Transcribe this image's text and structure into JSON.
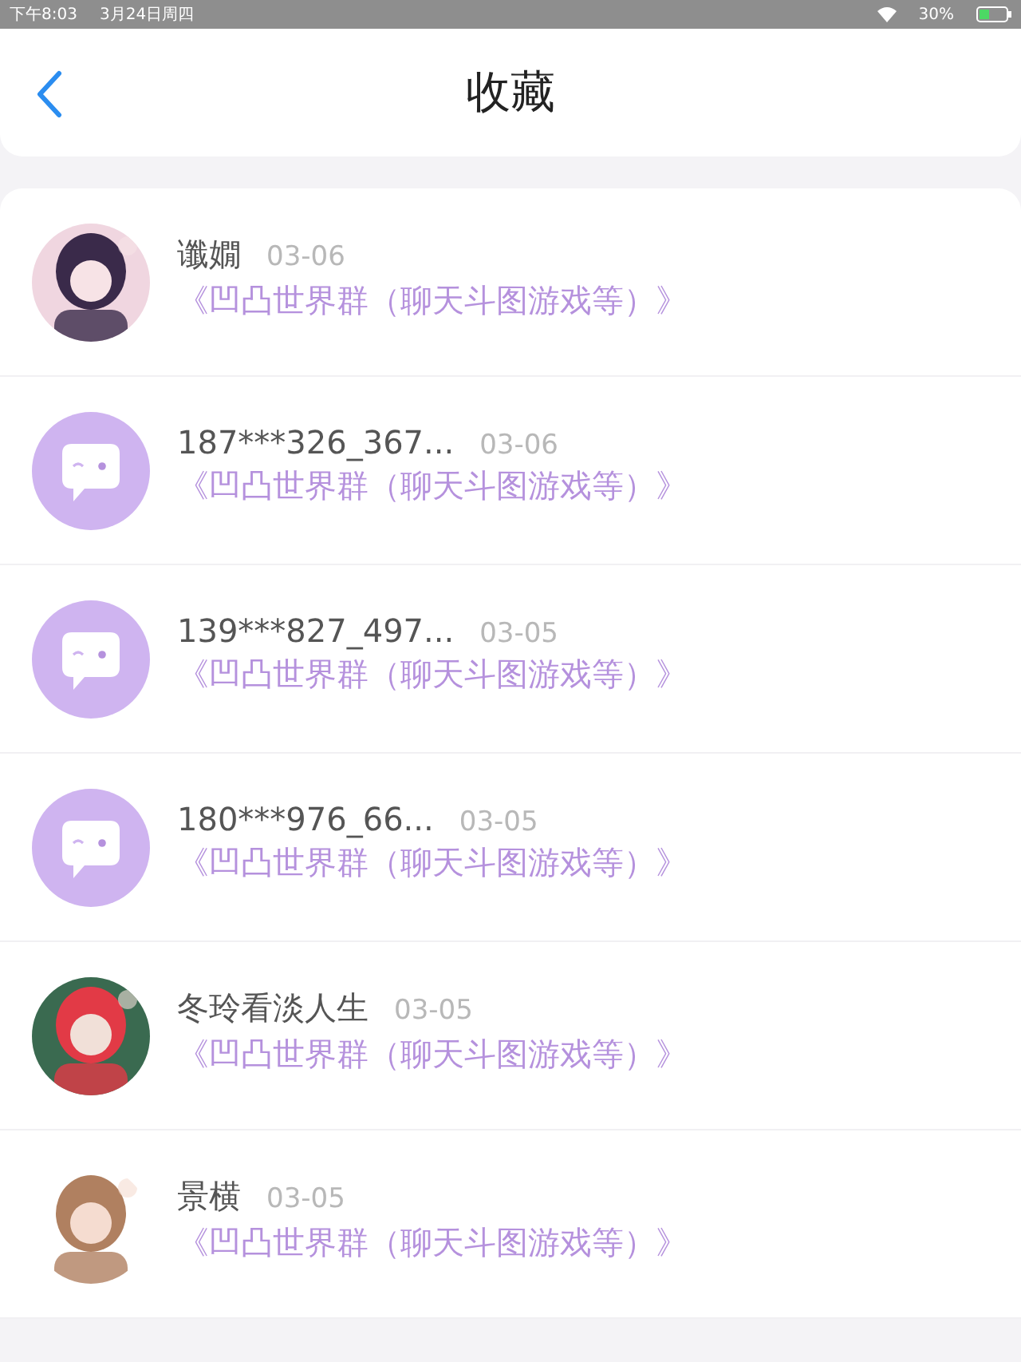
{
  "status_bar": {
    "time": "下午8:03",
    "date": "3月24日周四",
    "battery": "30%"
  },
  "header": {
    "title": "收藏"
  },
  "items": [
    {
      "kind": "picture",
      "name": "谶嫺",
      "date": "03-06",
      "group": "《凹凸世界群（聊天斗图游戏等）》"
    },
    {
      "kind": "default",
      "name": "187***326_367...",
      "date": "03-06",
      "group": "《凹凸世界群（聊天斗图游戏等）》"
    },
    {
      "kind": "default",
      "name": "139***827_497...",
      "date": "03-05",
      "group": "《凹凸世界群（聊天斗图游戏等）》"
    },
    {
      "kind": "default",
      "name": "180***976_66...",
      "date": "03-05",
      "group": "《凹凸世界群（聊天斗图游戏等）》"
    },
    {
      "kind": "picture",
      "name": "冬玲看淡人生",
      "date": "03-05",
      "group": "《凹凸世界群（聊天斗图游戏等）》"
    },
    {
      "kind": "picture",
      "name": "景横",
      "date": "03-05",
      "group": "《凹凸世界群（聊天斗图游戏等）》"
    }
  ]
}
